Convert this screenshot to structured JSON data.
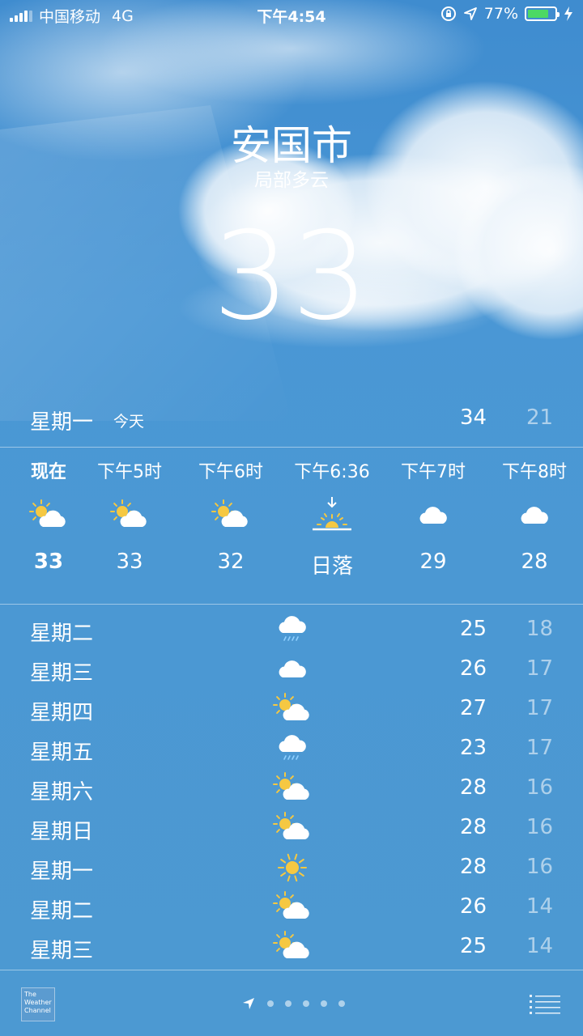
{
  "status_bar": {
    "carrier": "中国移动",
    "network": "4G",
    "time": "下午4:54",
    "battery_percent": "77%",
    "battery_level": 0.77,
    "icons": [
      "signal-icon",
      "orientation-lock-icon",
      "location-arrow-icon",
      "battery-icon",
      "charging-bolt-icon"
    ]
  },
  "location": {
    "city": "安国市",
    "condition": "局部多云",
    "temperature": "33"
  },
  "today": {
    "day": "星期一",
    "label": "今天",
    "high": "34",
    "low": "21"
  },
  "hourly": [
    {
      "time": "现在",
      "icon": "partly-cloudy-icon",
      "value": "33"
    },
    {
      "time": "下午5时",
      "icon": "partly-cloudy-icon",
      "value": "33"
    },
    {
      "time": "下午6时",
      "icon": "partly-cloudy-icon",
      "value": "32"
    },
    {
      "time": "下午6:36",
      "icon": "sunset-icon",
      "value": "日落"
    },
    {
      "time": "下午7时",
      "icon": "cloud-icon",
      "value": "29"
    },
    {
      "time": "下午8时",
      "icon": "cloud-icon",
      "value": "28"
    }
  ],
  "daily": [
    {
      "day": "星期二",
      "icon": "rain-icon",
      "high": "25",
      "low": "18"
    },
    {
      "day": "星期三",
      "icon": "cloud-icon",
      "high": "26",
      "low": "17"
    },
    {
      "day": "星期四",
      "icon": "partly-cloudy-icon",
      "high": "27",
      "low": "17"
    },
    {
      "day": "星期五",
      "icon": "rain-icon",
      "high": "23",
      "low": "17"
    },
    {
      "day": "星期六",
      "icon": "partly-cloudy-icon",
      "high": "28",
      "low": "16"
    },
    {
      "day": "星期日",
      "icon": "partly-cloudy-icon",
      "high": "28",
      "low": "16"
    },
    {
      "day": "星期一",
      "icon": "sun-icon",
      "high": "28",
      "low": "16"
    },
    {
      "day": "星期二",
      "icon": "partly-cloudy-icon",
      "high": "26",
      "low": "14"
    },
    {
      "day": "星期三",
      "icon": "partly-cloudy-icon",
      "high": "25",
      "low": "14"
    }
  ],
  "bottom_bar": {
    "logo_lines": [
      "The",
      "Weather",
      "Channel"
    ],
    "page_count": 5,
    "active_icon": "location-arrow-icon",
    "list_icon": "list-icon"
  },
  "colors": {
    "sky": "#4a97d5",
    "sun": "#f5c842",
    "battery": "#4cd964"
  }
}
